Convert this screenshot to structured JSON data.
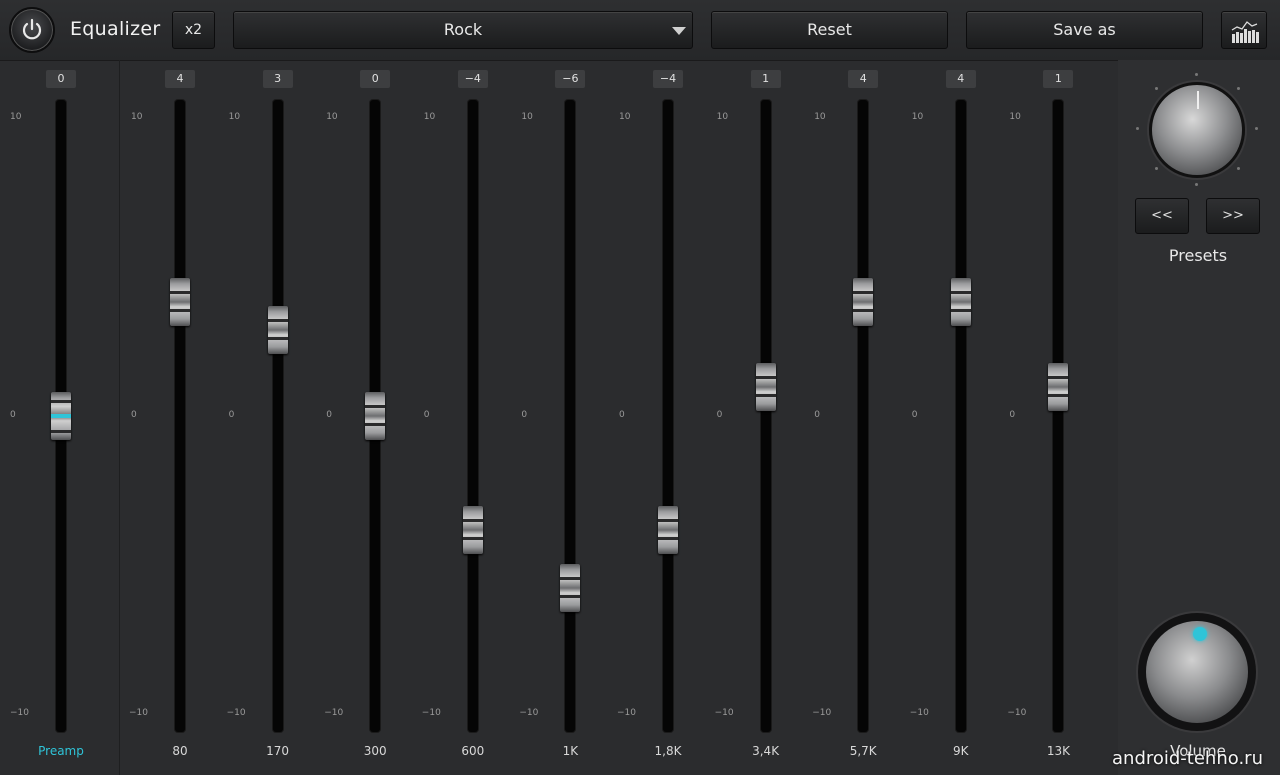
{
  "header": {
    "title": "Equalizer",
    "x2_label": "x2",
    "preset_selected": "Rock",
    "reset_label": "Reset",
    "save_as_label": "Save as"
  },
  "preamp": {
    "value": "0",
    "label": "Preamp",
    "scale_top": "10",
    "scale_mid": "0",
    "scale_bottom": "−10"
  },
  "bands": [
    {
      "freq": "80",
      "value": "4",
      "scale_top": "10",
      "scale_mid": "0",
      "scale_bottom": "−10"
    },
    {
      "freq": "170",
      "value": "3",
      "scale_top": "10",
      "scale_mid": "0",
      "scale_bottom": "−10"
    },
    {
      "freq": "300",
      "value": "0",
      "scale_top": "10",
      "scale_mid": "0",
      "scale_bottom": "−10"
    },
    {
      "freq": "600",
      "value": "−4",
      "scale_top": "10",
      "scale_mid": "0",
      "scale_bottom": "−10"
    },
    {
      "freq": "1K",
      "value": "−6",
      "scale_top": "10",
      "scale_mid": "0",
      "scale_bottom": "−10"
    },
    {
      "freq": "1,8K",
      "value": "−4",
      "scale_top": "10",
      "scale_mid": "0",
      "scale_bottom": "−10"
    },
    {
      "freq": "3,4K",
      "value": "1",
      "scale_top": "10",
      "scale_mid": "0",
      "scale_bottom": "−10"
    },
    {
      "freq": "5,7K",
      "value": "4",
      "scale_top": "10",
      "scale_mid": "0",
      "scale_bottom": "−10"
    },
    {
      "freq": "9K",
      "value": "4",
      "scale_top": "10",
      "scale_mid": "0",
      "scale_bottom": "−10"
    },
    {
      "freq": "13K",
      "value": "1",
      "scale_top": "10",
      "scale_mid": "0",
      "scale_bottom": "−10"
    }
  ],
  "side": {
    "prev_label": "<<",
    "next_label": ">>",
    "presets_label": "Presets",
    "volume_label": "Volume"
  },
  "watermark": "android-tehno.ru",
  "colors": {
    "accent": "#2fc4d8",
    "background": "#2b2c2e"
  }
}
